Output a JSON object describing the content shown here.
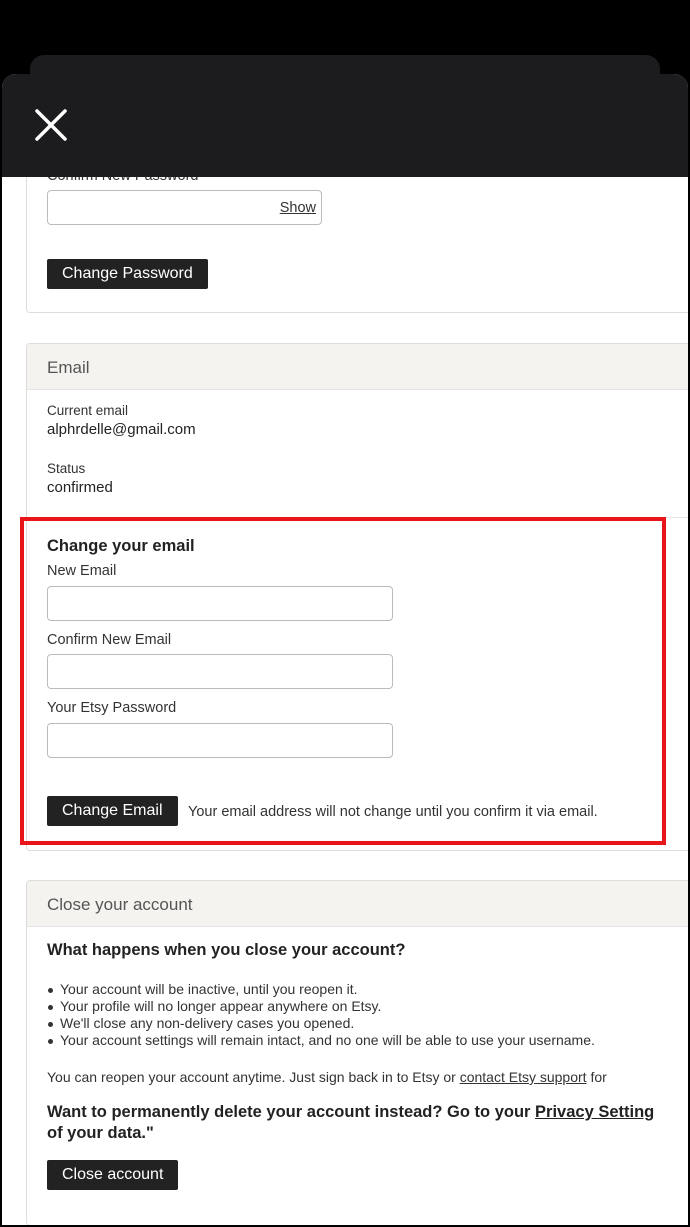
{
  "password_section": {
    "confirm_label": "Confirm New Password",
    "show_link": "Show",
    "change_button": "Change Password"
  },
  "email_section": {
    "title": "Email",
    "current_email_label": "Current email",
    "current_email": "alphrdelle@gmail.com",
    "status_label": "Status",
    "status": "confirmed",
    "change_heading": "Change your email",
    "new_email_label": "New Email",
    "confirm_email_label": "Confirm New Email",
    "password_label": "Your Etsy Password",
    "change_button": "Change Email",
    "note": "Your email address will not change until you confirm it via email."
  },
  "close_section": {
    "title": "Close your account",
    "question": "What happens when you close your account?",
    "bullets": [
      "Your account will be inactive, until you reopen it.",
      "Your profile will no longer appear anywhere on Etsy.",
      "We'll close any non-delivery cases you opened.",
      "Your account settings will remain intact, and no one will be able to use your username."
    ],
    "reopen_text": "You can reopen your account anytime. Just sign back in to Etsy or ",
    "support_link": "contact Etsy support",
    "reopen_tail": " for",
    "delete_text": "Want to permanently delete your account instead? Go to your ",
    "privacy_link": "Privacy Setting",
    "delete_line2": "of your data.\"",
    "close_button": "Close account"
  },
  "colors": {
    "highlight": "#e8161b",
    "button": "#222222",
    "header": "#1c1c1e"
  }
}
